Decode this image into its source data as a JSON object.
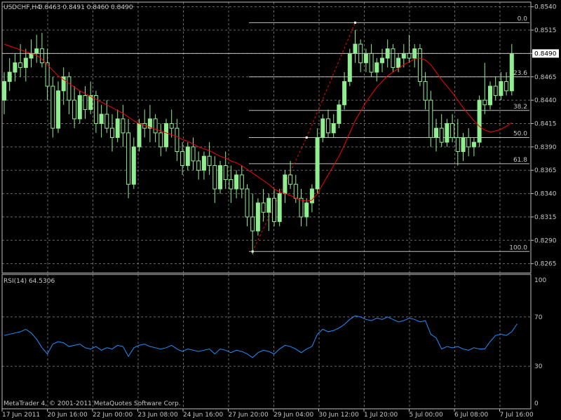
{
  "header": {
    "symbol": "USDCHF,H4",
    "ohlc": "0.8463 0.8491 0.8460 0.8490"
  },
  "footer": {
    "copyright": "MetaTrader 4, © 2001-2011 MetaQuotes Software Corp."
  },
  "colors": {
    "background": "#000000",
    "grid": "#c0c0c0",
    "bull": "#90ee90",
    "bear": "#000000",
    "candle_outline": "#90ee90",
    "ma": "#ff0000",
    "rsi": "#1e90ff",
    "fibo": "#c0c0c0",
    "zigzag": "#ff0000",
    "text": "#c8c8c8",
    "current_price_label": "#ffffff"
  },
  "chart_data": [
    {
      "type": "candlestick",
      "title": "USDCHF,H4",
      "ylim": [
        0.8255,
        0.8545
      ],
      "y_ticks": [
        "0.8540",
        "0.8515",
        "0.8490",
        "0.8465",
        "0.8440",
        "0.8415",
        "0.8390",
        "0.8365",
        "0.8340",
        "0.8315",
        "0.8290",
        "0.8265"
      ],
      "x_ticks": [
        "17 Jun 2011",
        "20 Jun 16:00",
        "22 Jun 00:00",
        "23 Jun 08:00",
        "24 Jun 16:00",
        "27 Jun 20:00",
        "29 Jun 04:00",
        "30 Jun 12:00",
        "1 Jul 20:00",
        "5 Jul 00:00",
        "6 Jul 08:00",
        "7 Jul 16:00"
      ],
      "current_price": "0.8490",
      "candles": [
        [
          0.844,
          0.847,
          0.8425,
          0.846
        ],
        [
          0.846,
          0.8485,
          0.845,
          0.847
        ],
        [
          0.847,
          0.849,
          0.846,
          0.848
        ],
        [
          0.848,
          0.85,
          0.8465,
          0.8475
        ],
        [
          0.8475,
          0.8495,
          0.846,
          0.8485
        ],
        [
          0.8485,
          0.8505,
          0.8475,
          0.849
        ],
        [
          0.849,
          0.851,
          0.848,
          0.8495
        ],
        [
          0.8495,
          0.8512,
          0.8475,
          0.848
        ],
        [
          0.848,
          0.8495,
          0.844,
          0.8455
        ],
        [
          0.8455,
          0.8465,
          0.84,
          0.841
        ],
        [
          0.841,
          0.846,
          0.8405,
          0.845
        ],
        [
          0.845,
          0.8475,
          0.8435,
          0.8465
        ],
        [
          0.8465,
          0.847,
          0.8425,
          0.844
        ],
        [
          0.844,
          0.8455,
          0.841,
          0.842
        ],
        [
          0.842,
          0.845,
          0.8415,
          0.8445
        ],
        [
          0.8445,
          0.8455,
          0.842,
          0.843
        ],
        [
          0.843,
          0.846,
          0.8425,
          0.8445
        ],
        [
          0.8445,
          0.845,
          0.8405,
          0.8415
        ],
        [
          0.8415,
          0.8435,
          0.84,
          0.8425
        ],
        [
          0.8425,
          0.844,
          0.8405,
          0.841
        ],
        [
          0.841,
          0.8425,
          0.8385,
          0.84
        ],
        [
          0.84,
          0.843,
          0.8395,
          0.842
        ],
        [
          0.842,
          0.8435,
          0.839,
          0.8405
        ],
        [
          0.8405,
          0.842,
          0.8335,
          0.835
        ],
        [
          0.835,
          0.84,
          0.8345,
          0.839
        ],
        [
          0.839,
          0.842,
          0.8385,
          0.8415
        ],
        [
          0.8415,
          0.843,
          0.84,
          0.841
        ],
        [
          0.841,
          0.8435,
          0.8395,
          0.842
        ],
        [
          0.842,
          0.8425,
          0.8395,
          0.8405
        ],
        [
          0.8405,
          0.8415,
          0.838,
          0.839
        ],
        [
          0.839,
          0.842,
          0.8385,
          0.8415
        ],
        [
          0.8415,
          0.843,
          0.84,
          0.841
        ],
        [
          0.841,
          0.842,
          0.8375,
          0.8385
        ],
        [
          0.8385,
          0.8395,
          0.836,
          0.837
        ],
        [
          0.837,
          0.8395,
          0.8365,
          0.839
        ],
        [
          0.839,
          0.84,
          0.8365,
          0.8375
        ],
        [
          0.8375,
          0.8385,
          0.8355,
          0.8365
        ],
        [
          0.8365,
          0.8385,
          0.8355,
          0.838
        ],
        [
          0.838,
          0.8395,
          0.836,
          0.837
        ],
        [
          0.837,
          0.838,
          0.833,
          0.8345
        ],
        [
          0.8345,
          0.8375,
          0.834,
          0.837
        ],
        [
          0.837,
          0.8385,
          0.8345,
          0.8355
        ],
        [
          0.8355,
          0.837,
          0.833,
          0.8345
        ],
        [
          0.8345,
          0.8365,
          0.8335,
          0.836
        ],
        [
          0.836,
          0.837,
          0.8335,
          0.8345
        ],
        [
          0.8345,
          0.835,
          0.8305,
          0.8315
        ],
        [
          0.8315,
          0.834,
          0.8275,
          0.83
        ],
        [
          0.83,
          0.8335,
          0.8295,
          0.833
        ],
        [
          0.833,
          0.8345,
          0.831,
          0.832
        ],
        [
          0.832,
          0.834,
          0.83,
          0.8335
        ],
        [
          0.8335,
          0.8345,
          0.8305,
          0.831
        ],
        [
          0.831,
          0.8345,
          0.8305,
          0.834
        ],
        [
          0.834,
          0.8365,
          0.833,
          0.836
        ],
        [
          0.836,
          0.8375,
          0.8345,
          0.835
        ],
        [
          0.835,
          0.836,
          0.833,
          0.8335
        ],
        [
          0.8335,
          0.8345,
          0.8305,
          0.8315
        ],
        [
          0.8315,
          0.8335,
          0.8305,
          0.833
        ],
        [
          0.833,
          0.835,
          0.832,
          0.8345
        ],
        [
          0.8345,
          0.841,
          0.834,
          0.84
        ],
        [
          0.84,
          0.8425,
          0.8395,
          0.842
        ],
        [
          0.842,
          0.843,
          0.84,
          0.8405
        ],
        [
          0.8405,
          0.8425,
          0.84,
          0.8415
        ],
        [
          0.8415,
          0.844,
          0.841,
          0.8435
        ],
        [
          0.8435,
          0.847,
          0.843,
          0.846
        ],
        [
          0.846,
          0.8495,
          0.8455,
          0.849
        ],
        [
          0.849,
          0.8515,
          0.848,
          0.85
        ],
        [
          0.85,
          0.8505,
          0.847,
          0.848
        ],
        [
          0.848,
          0.8495,
          0.847,
          0.849
        ],
        [
          0.849,
          0.85,
          0.8465,
          0.847
        ],
        [
          0.847,
          0.8485,
          0.846,
          0.848
        ],
        [
          0.848,
          0.8495,
          0.847,
          0.8485
        ],
        [
          0.8485,
          0.8505,
          0.8475,
          0.8495
        ],
        [
          0.8495,
          0.85,
          0.847,
          0.8475
        ],
        [
          0.8475,
          0.849,
          0.847,
          0.8485
        ],
        [
          0.8485,
          0.85,
          0.8475,
          0.849
        ],
        [
          0.849,
          0.851,
          0.848,
          0.8485
        ],
        [
          0.8485,
          0.85,
          0.8475,
          0.8495
        ],
        [
          0.8495,
          0.85,
          0.8455,
          0.846
        ],
        [
          0.846,
          0.847,
          0.843,
          0.844
        ],
        [
          0.844,
          0.845,
          0.839,
          0.84
        ],
        [
          0.84,
          0.842,
          0.8385,
          0.841
        ],
        [
          0.841,
          0.8425,
          0.839,
          0.8395
        ],
        [
          0.8395,
          0.842,
          0.839,
          0.8415
        ],
        [
          0.8415,
          0.8425,
          0.8395,
          0.84
        ],
        [
          0.84,
          0.842,
          0.837,
          0.8385
        ],
        [
          0.8385,
          0.8405,
          0.8375,
          0.84
        ],
        [
          0.84,
          0.841,
          0.838,
          0.839
        ],
        [
          0.839,
          0.84,
          0.838,
          0.8395
        ],
        [
          0.8395,
          0.8445,
          0.839,
          0.844
        ],
        [
          0.844,
          0.848,
          0.8425,
          0.8435
        ],
        [
          0.8435,
          0.846,
          0.843,
          0.8455
        ],
        [
          0.8455,
          0.8465,
          0.844,
          0.8445
        ],
        [
          0.8445,
          0.847,
          0.844,
          0.846
        ],
        [
          0.846,
          0.847,
          0.8445,
          0.845
        ],
        [
          0.845,
          0.85,
          0.8445,
          0.849
        ]
      ],
      "moving_average": [
        0.85,
        0.8498,
        0.8496,
        0.8494,
        0.8492,
        0.849,
        0.8488,
        0.8484,
        0.8478,
        0.8472,
        0.8466,
        0.8462,
        0.8458,
        0.8454,
        0.845,
        0.8447,
        0.8444,
        0.8441,
        0.8438,
        0.8435,
        0.8432,
        0.8429,
        0.8426,
        0.8422,
        0.8418,
        0.8415,
        0.8413,
        0.8411,
        0.8409,
        0.8407,
        0.8405,
        0.8403,
        0.8401,
        0.8398,
        0.8396,
        0.8393,
        0.839,
        0.8388,
        0.8386,
        0.8383,
        0.838,
        0.8378,
        0.8375,
        0.8373,
        0.837,
        0.8366,
        0.8362,
        0.8358,
        0.8354,
        0.835,
        0.8345,
        0.8342,
        0.834,
        0.8338,
        0.8335,
        0.8333,
        0.8332,
        0.8333,
        0.834,
        0.835,
        0.836,
        0.837,
        0.838,
        0.8392,
        0.8405,
        0.8418,
        0.8428,
        0.8438,
        0.8446,
        0.8454,
        0.846,
        0.8466,
        0.847,
        0.8474,
        0.8478,
        0.8481,
        0.8484,
        0.8485,
        0.8483,
        0.8478,
        0.847,
        0.8462,
        0.8455,
        0.8448,
        0.844,
        0.8432,
        0.8425,
        0.8418,
        0.8412,
        0.8408,
        0.8406,
        0.8407,
        0.8409,
        0.8412,
        0.8416
      ],
      "fibonacci": {
        "high": 0.8523,
        "low": 0.8278,
        "levels": [
          {
            "label": "0.0",
            "value": 0.8523
          },
          {
            "label": "23.6",
            "value": 0.8465
          },
          {
            "label": "38.2",
            "value": 0.8429
          },
          {
            "label": "50.0",
            "value": 0.84
          },
          {
            "label": "61.8",
            "value": 0.8372
          },
          {
            "label": "100.0",
            "value": 0.8278
          }
        ]
      },
      "zigzag": [
        {
          "index": 46,
          "value": 0.8278
        },
        {
          "index": 56,
          "value": 0.84
        },
        {
          "index": 65,
          "value": 0.8523
        }
      ]
    },
    {
      "type": "line",
      "title": "RSI(14) 64.5306",
      "ylim": [
        0,
        100
      ],
      "y_ticks": [
        "100",
        "70",
        "30",
        "0"
      ],
      "levels": [
        70,
        30
      ],
      "series": [
        {
          "name": "RSI(14)",
          "values": [
            55,
            56,
            57,
            58,
            60,
            57,
            52,
            45,
            40,
            48,
            50,
            49,
            46,
            47,
            48,
            45,
            44,
            46,
            43,
            45,
            44,
            47,
            46,
            38,
            45,
            47,
            48,
            46,
            45,
            44,
            45,
            47,
            44,
            42,
            44,
            43,
            42,
            43,
            44,
            40,
            44,
            43,
            41,
            43,
            42,
            40,
            37,
            41,
            43,
            42,
            40,
            44,
            47,
            46,
            44,
            41,
            44,
            46,
            56,
            60,
            58,
            59,
            61,
            64,
            68,
            71,
            70,
            68,
            67,
            69,
            68,
            70,
            68,
            66,
            67,
            69,
            68,
            66,
            67,
            56,
            53,
            44,
            46,
            45,
            46,
            44,
            43,
            45,
            44,
            44,
            50,
            55,
            56,
            55,
            58,
            64.5
          ]
        }
      ]
    }
  ]
}
